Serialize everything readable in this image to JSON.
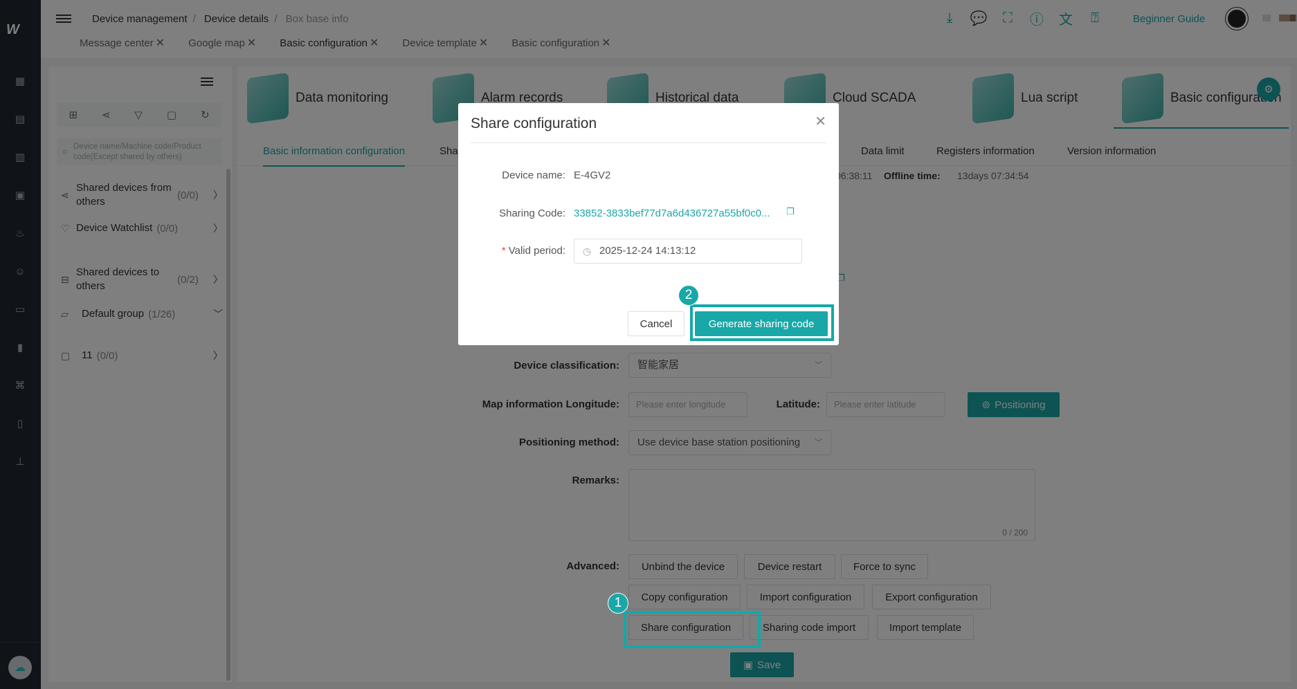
{
  "colors": {
    "accent": "#1aa7a7",
    "rail": "#20262e"
  },
  "header": {
    "breadcrumb": [
      "Device management",
      "Device details",
      "Box base info"
    ],
    "tabs": [
      "Message center",
      "Google map",
      "Basic configuration",
      "Device template",
      "Basic configuration"
    ],
    "guide_label": "Beginner Guide",
    "icons": [
      "download-icon",
      "chat-icon",
      "fullscreen-icon",
      "info-icon",
      "translate-icon",
      "help-book-icon"
    ]
  },
  "sidebar": {
    "search_placeholder": "Device name/Machine code/Product code(Except shared by others)",
    "groups": [
      {
        "label": "Shared devices from others",
        "count": "(0/0)"
      },
      {
        "label": "Device Watchlist",
        "count": "(0/0)"
      },
      {
        "label": "Shared devices to others",
        "count": "(0/2)"
      },
      {
        "label": "Default group",
        "count": "(1/26)"
      },
      {
        "label": "11",
        "count": "(0/0)"
      }
    ]
  },
  "main": {
    "modules": [
      "Data monitoring",
      "Alarm records",
      "Historical data",
      "Cloud SCADA",
      "Lua script",
      "Basic configuration"
    ],
    "subtabs": [
      "Basic information configuration",
      "Sha",
      "Data limit",
      "Registers information",
      "Version information"
    ],
    "info": {
      "time_partial": "06:38:11",
      "offline_label": "Offline time:",
      "offline_value": "13days 07:34:54"
    },
    "form": {
      "classification_label": "Device classification:",
      "classification_value": "智能家居",
      "longitude_label": "Map information Longitude:",
      "longitude_placeholder": "Please enter longitude",
      "latitude_label": "Latitude:",
      "latitude_placeholder": "Please enter latitude",
      "positioning_button": "Positioning",
      "method_label": "Positioning method:",
      "method_value": "Use device base station positioning",
      "remarks_label": "Remarks:",
      "remarks_counter": "0 / 200",
      "advanced_label": "Advanced:",
      "buttons": [
        "Unbind the device",
        "Device restart",
        "Force to sync",
        "Copy configuration",
        "Import configuration",
        "Export configuration",
        "Share configuration",
        "Sharing code import",
        "Import template"
      ],
      "save_label": "Save"
    }
  },
  "dialog": {
    "title": "Share configuration",
    "device_name_label": "Device name:",
    "device_name": "E-4GV2",
    "sharing_code_label": "Sharing Code:",
    "sharing_code": "33852-3833bef77d7a6d436727a55bf0c0...",
    "valid_label": "Valid period:",
    "valid_value": "2025-12-24 14:13:12",
    "cancel_label": "Cancel",
    "generate_label": "Generate sharing code"
  },
  "markers": [
    "1",
    "2"
  ]
}
